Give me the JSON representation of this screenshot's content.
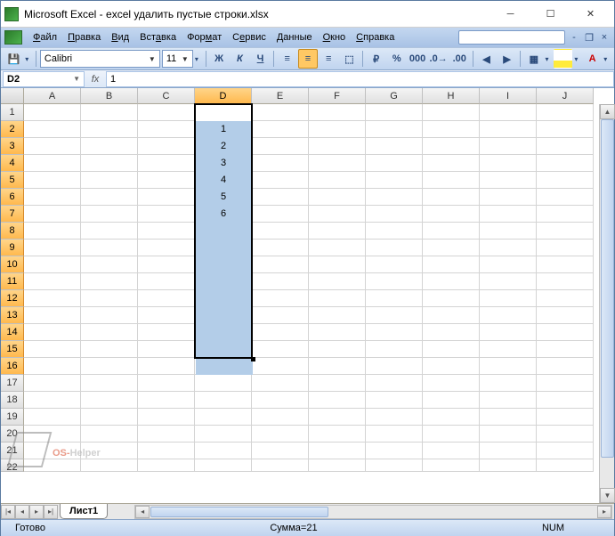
{
  "title": "Microsoft Excel - excel удалить пустые строки.xlsx",
  "menu": {
    "file": "Файл",
    "edit": "Правка",
    "view": "Вид",
    "insert": "Вставка",
    "format": "Формат",
    "tools": "Сервис",
    "data": "Данные",
    "window": "Окно",
    "help": "Справка"
  },
  "font": {
    "name": "Calibri",
    "size": "11"
  },
  "namebox": "D2",
  "formula": "1",
  "columns": [
    "A",
    "B",
    "C",
    "D",
    "E",
    "F",
    "G",
    "H",
    "I",
    "J"
  ],
  "selected_col_index": 3,
  "rows_visible": 22,
  "selected_rows": [
    2,
    3,
    4,
    5,
    6,
    7,
    8,
    9,
    10,
    11,
    12,
    13,
    14,
    15,
    16
  ],
  "cell_values": {
    "D2": "1",
    "D3": "2",
    "D4": "3",
    "D5": "4",
    "D6": "5",
    "D7": "6",
    "D8": "",
    "D9": "",
    "D10": "",
    "D11": "",
    "D12": "",
    "D13": "",
    "D14": "",
    "D15": "",
    "D16": ""
  },
  "sheet_tab": "Лист1",
  "status": {
    "ready": "Готово",
    "sum": "Сумма=21",
    "num": "NUM"
  },
  "watermark": {
    "a": "OS-",
    "b": "Helper"
  },
  "fmt": {
    "bold": "Ж",
    "italic": "К",
    "underline": "Ч"
  },
  "currency": "₽",
  "percent": "%"
}
